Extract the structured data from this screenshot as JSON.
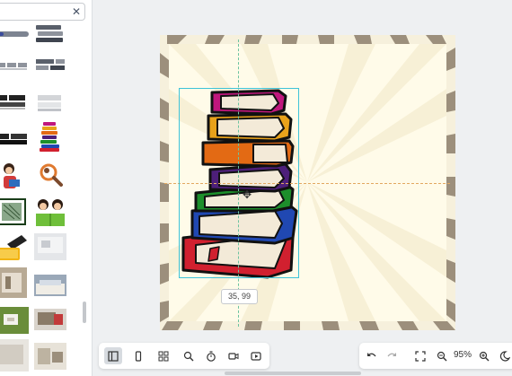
{
  "search": {
    "value": "",
    "placeholder": ""
  },
  "icons": {
    "clear": "close-icon",
    "sidebar_toggle": "panel-icon",
    "toolbar_left": [
      "panel-icon",
      "page-icon",
      "grid-icon",
      "search-icon",
      "timer-icon",
      "video-icon",
      "present-icon"
    ],
    "toolbar_right": [
      "undo-icon",
      "redo-icon",
      "fullscreen-icon",
      "zoom-out-icon",
      "zoom-in-icon",
      "dark-mode-icon"
    ]
  },
  "canvas": {
    "coord_readout": "35, 99"
  },
  "zoom": {
    "value": "95%"
  },
  "colors": {
    "selection": "#3ec3d8",
    "canvas_bg": "#fffbe9",
    "frame_stripe": "#9c8f7c",
    "guide_vertical": "#6cc3a0",
    "guide_horizontal": "#e2a860"
  }
}
